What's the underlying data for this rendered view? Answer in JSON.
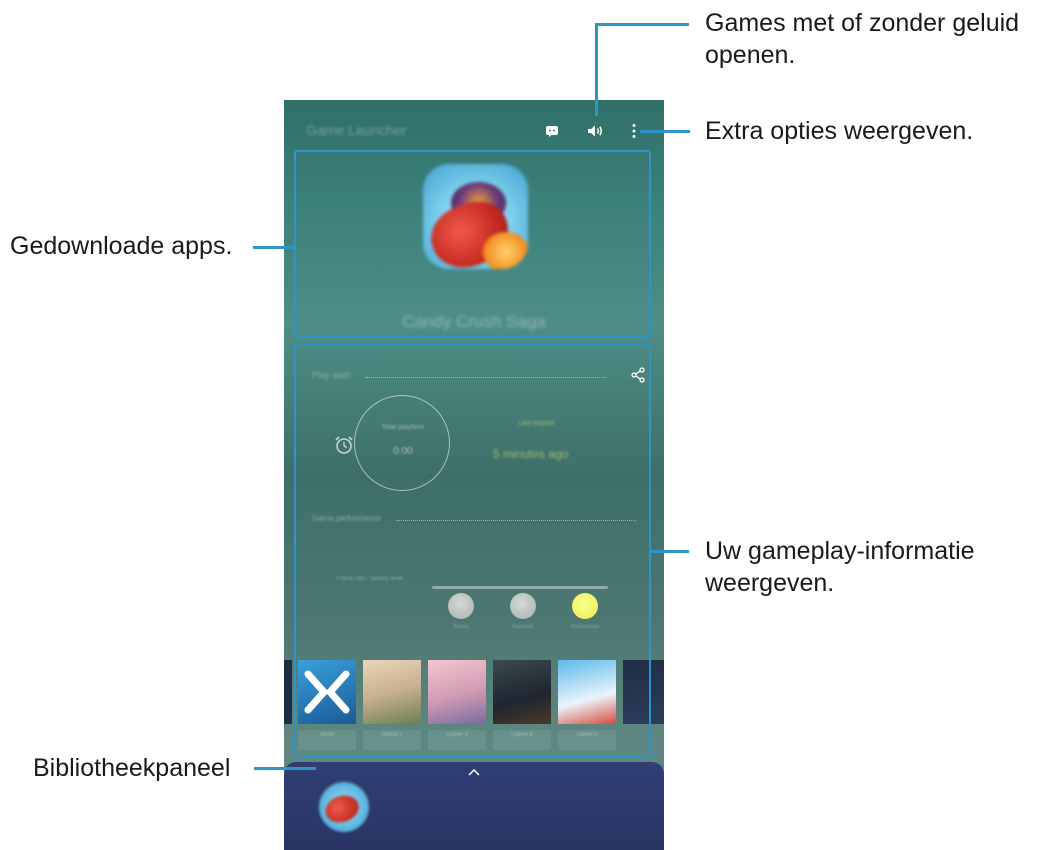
{
  "app": {
    "title": "Game Launcher",
    "featured_game": "Candy Crush Saga"
  },
  "stats": {
    "section_title": "Play stats",
    "playtime_label": "Total playtime",
    "playtime_value": "0:00",
    "last_played_label": "Last played",
    "last_played_value": "5 minutes ago",
    "performance_title": "Game performance",
    "performance_side_label": "Frame rate / battery level",
    "performance_options": [
      "Battery",
      "Balanced",
      "Performance"
    ],
    "selected_option_index": 2
  },
  "carousel": {
    "tiles": [
      {
        "label": "Store",
        "color": "#2f7fb4"
      },
      {
        "label": "Game 2",
        "color": "#c9b49a"
      },
      {
        "label": "Game 3",
        "color": "#d6a0b5"
      },
      {
        "label": "Game 4",
        "color": "#2a3240"
      },
      {
        "label": "Game 5",
        "color": "#4aa0d8"
      }
    ]
  },
  "callouts": {
    "sound": "Games met of zonder geluid\nopenen.",
    "more": "Extra opties weergeven.",
    "downloaded": "Gedownloade apps.",
    "gameplay": "Uw gameplay-informatie\nweergeven.",
    "library": "Bibliotheekpaneel"
  },
  "colors": {
    "accent": "#2e94c6",
    "phone_bg": "#3c817a",
    "library_bg": "#2f3f74",
    "selected_mode": "#e9ed52"
  }
}
